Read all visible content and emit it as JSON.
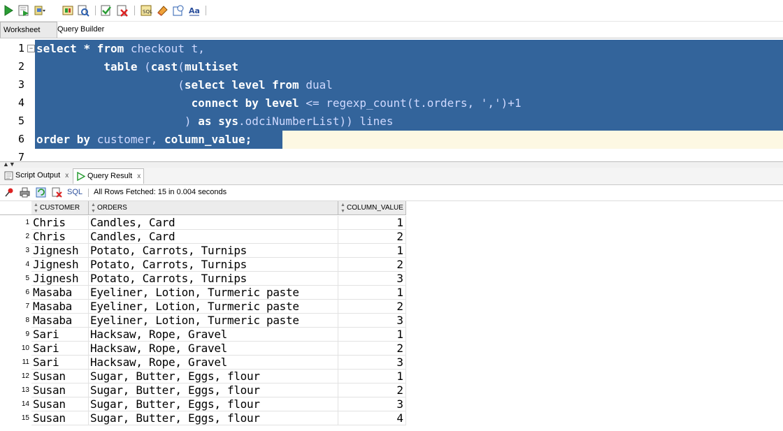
{
  "editor_tabs": [
    {
      "label": "Worksheet",
      "active": true
    },
    {
      "label": "Query Builder",
      "active": false
    }
  ],
  "editor": {
    "line_numbers": [
      "1",
      "2",
      "3",
      "4",
      "5",
      "6",
      "7"
    ],
    "lines": [
      [
        {
          "t": "select",
          "c": "kw"
        },
        {
          "t": " ",
          "c": "lit"
        },
        {
          "t": "*",
          "c": "kw"
        },
        {
          "t": " ",
          "c": "lit"
        },
        {
          "t": "from",
          "c": "kw"
        },
        {
          "t": " checkout t,",
          "c": "id"
        }
      ],
      [
        {
          "t": "          ",
          "c": "lit"
        },
        {
          "t": "table",
          "c": "kw"
        },
        {
          "t": " (",
          "c": "id"
        },
        {
          "t": "cast",
          "c": "kw"
        },
        {
          "t": "(",
          "c": "id"
        },
        {
          "t": "multiset",
          "c": "kw"
        }
      ],
      [
        {
          "t": "                     (",
          "c": "id"
        },
        {
          "t": "select level from",
          "c": "kw"
        },
        {
          "t": " dual",
          "c": "id"
        }
      ],
      [
        {
          "t": "                       ",
          "c": "lit"
        },
        {
          "t": "connect by level",
          "c": "kw"
        },
        {
          "t": " <= regexp_count(t.orders, ','",
          "c": "id"
        },
        {
          "t": ")+1",
          "c": "id"
        }
      ],
      [
        {
          "t": "                      ) ",
          "c": "id"
        },
        {
          "t": "as sys",
          "c": "kw"
        },
        {
          "t": ".odciNumberList)) lines",
          "c": "id"
        }
      ],
      [
        {
          "t": "order by",
          "c": "kw"
        },
        {
          "t": " customer, ",
          "c": "id"
        },
        {
          "t": "column_value;",
          "c": "kw"
        }
      ]
    ]
  },
  "result_tabs": [
    {
      "label": "Script Output",
      "close": "x"
    },
    {
      "label": "Query Result",
      "close": "x"
    }
  ],
  "result_toolbar": {
    "sql_label": "SQL",
    "status": "All Rows Fetched: 15 in 0.004 seconds"
  },
  "grid": {
    "columns": [
      "CUSTOMER",
      "ORDERS",
      "COLUMN_VALUE"
    ],
    "rows": [
      [
        "1",
        "Chris",
        "Candles, Card",
        "1"
      ],
      [
        "2",
        "Chris",
        "Candles, Card",
        "2"
      ],
      [
        "3",
        "Jignesh",
        "Potato, Carrots, Turnips",
        "1"
      ],
      [
        "4",
        "Jignesh",
        "Potato, Carrots, Turnips",
        "2"
      ],
      [
        "5",
        "Jignesh",
        "Potato, Carrots, Turnips",
        "3"
      ],
      [
        "6",
        "Masaba",
        "Eyeliner, Lotion, Turmeric paste",
        "1"
      ],
      [
        "7",
        "Masaba",
        "Eyeliner, Lotion, Turmeric paste",
        "2"
      ],
      [
        "8",
        "Masaba",
        "Eyeliner, Lotion, Turmeric paste",
        "3"
      ],
      [
        "9",
        "Sari",
        "Hacksaw, Rope, Gravel",
        "1"
      ],
      [
        "10",
        "Sari",
        "Hacksaw, Rope, Gravel",
        "2"
      ],
      [
        "11",
        "Sari",
        "Hacksaw, Rope, Gravel",
        "3"
      ],
      [
        "12",
        "Susan",
        "Sugar, Butter, Eggs, flour",
        "1"
      ],
      [
        "13",
        "Susan",
        "Sugar, Butter, Eggs, flour",
        "2"
      ],
      [
        "14",
        "Susan",
        "Sugar, Butter, Eggs, flour",
        "3"
      ],
      [
        "15",
        "Susan",
        "Sugar, Butter, Eggs, flour",
        "4"
      ]
    ]
  },
  "icons": {
    "toolbar": [
      "run-statement-icon",
      "run-script-icon",
      "commit-icon",
      "rollback-icon",
      "autotrace-icon",
      "explain-plan-icon",
      "sql-tuning-icon",
      "clear-icon",
      "history-icon",
      "case-toggle-icon"
    ],
    "result_toolbar": [
      "pin-icon",
      "print-icon",
      "refresh-icon",
      "freeze-icon"
    ]
  },
  "colors": {
    "selection": "#33649b",
    "current_line": "#fdf8e3",
    "run_green": "#2a9d34"
  }
}
